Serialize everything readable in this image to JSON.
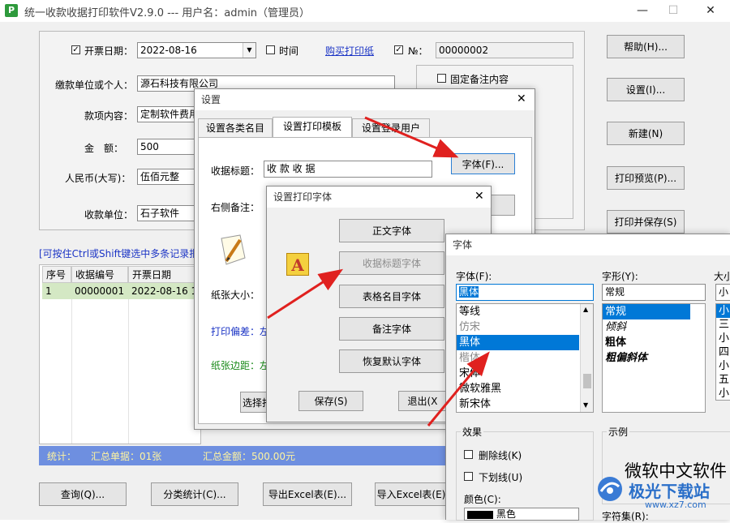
{
  "window": {
    "title": "统一收款收据打印软件V2.9.0 --- 用户名：admin（管理员）",
    "controls": {
      "minimize": "—",
      "maximize": "☐",
      "close": "✕"
    }
  },
  "form": {
    "date_checkbox_label": "开票日期：",
    "date_value": "2022-08-16",
    "time_checkbox_label": "时间",
    "buy_link": "购买打印纸",
    "no_label": "№：",
    "no_value": "00000002",
    "payer_label": "缴款单位或个人：",
    "payer_value": "源石科技有限公司",
    "content_label": "款项内容：",
    "content_value": "定制软件费用",
    "amount_label": "金　额：",
    "amount_value": "500",
    "rmb_label": "人民币(大写)：",
    "rmb_value": "伍佰元整",
    "receiver_label": "收款单位：",
    "receiver_value": "石子软件",
    "fixed_note_label": "固定备注内容"
  },
  "side_buttons": [
    "帮助(H)...",
    "设置(I)...",
    "新建(N)",
    "打印预览(P)...",
    "打印并保存(S)"
  ],
  "hint": "[可按住Ctrl或Shift键选中多条记录批",
  "table": {
    "headers": [
      "序号",
      "收据编号",
      "开票日期"
    ],
    "rows": [
      [
        "1",
        "00000001",
        "2022-08-16 1"
      ]
    ]
  },
  "stats": {
    "label": "统计：",
    "count_label": "汇总单据：01张",
    "sum_label": "汇总金额：500.00元"
  },
  "bottom_buttons": [
    "查询(Q)...",
    "分类统计(C)...",
    "导出Excel表(E)...",
    "导入Excel表(E)"
  ],
  "settings_dialog": {
    "title": "设置",
    "close": "✕",
    "tabs": [
      "设置各类名目",
      "设置打印模板",
      "设置登录用户"
    ],
    "print_title_label": "收据标题：",
    "print_title_value": "收 款 收 据",
    "font_button": "字体(F)...",
    "right_note_label": "右侧备注：",
    "paper_size_label": "纸张大小：",
    "print_offset_label": "打印偏差：左",
    "paper_margin_label": "纸张边距：左",
    "select_button": "选择打"
  },
  "print_font_dialog": {
    "title": "设置打印字体",
    "close": "✕",
    "icon_letter": "A",
    "buttons": [
      "正文字体",
      "收据标题字体",
      "表格名目字体",
      "备注字体",
      "恢复默认字体"
    ],
    "save_button": "保存(S)",
    "exit_button": "退出(X"
  },
  "font_dialog": {
    "title": "字体",
    "font_label": "字体(F):",
    "font_value": "黑体",
    "font_list": [
      "等线",
      "仿宋",
      "黑体",
      "楷体",
      "宋体",
      "微软雅黑",
      "新宋体"
    ],
    "style_label": "字形(Y):",
    "style_value": "常规",
    "style_list": [
      "常规",
      "倾斜",
      "粗体",
      "粗偏斜体"
    ],
    "size_label": "大小",
    "size_value": "小",
    "size_list": [
      "小",
      "三",
      "小",
      "四",
      "小",
      "五",
      "小"
    ],
    "effects_label": "效果",
    "strike_label": "删除线(K)",
    "underline_label": "下划线(U)",
    "color_label": "颜色(C):",
    "color_value": "黑色",
    "sample_label": "示例",
    "sample_text": "微软中文软件",
    "charset_label": "字符集(R):"
  },
  "watermark": {
    "brand": "极光下载站",
    "url": "www.xz7.com"
  },
  "colors": {
    "accent": "#0078d7",
    "stats_bar": "#6e8fe0",
    "row_selected": "#d4e8c4",
    "arrow": "#e0211f"
  }
}
